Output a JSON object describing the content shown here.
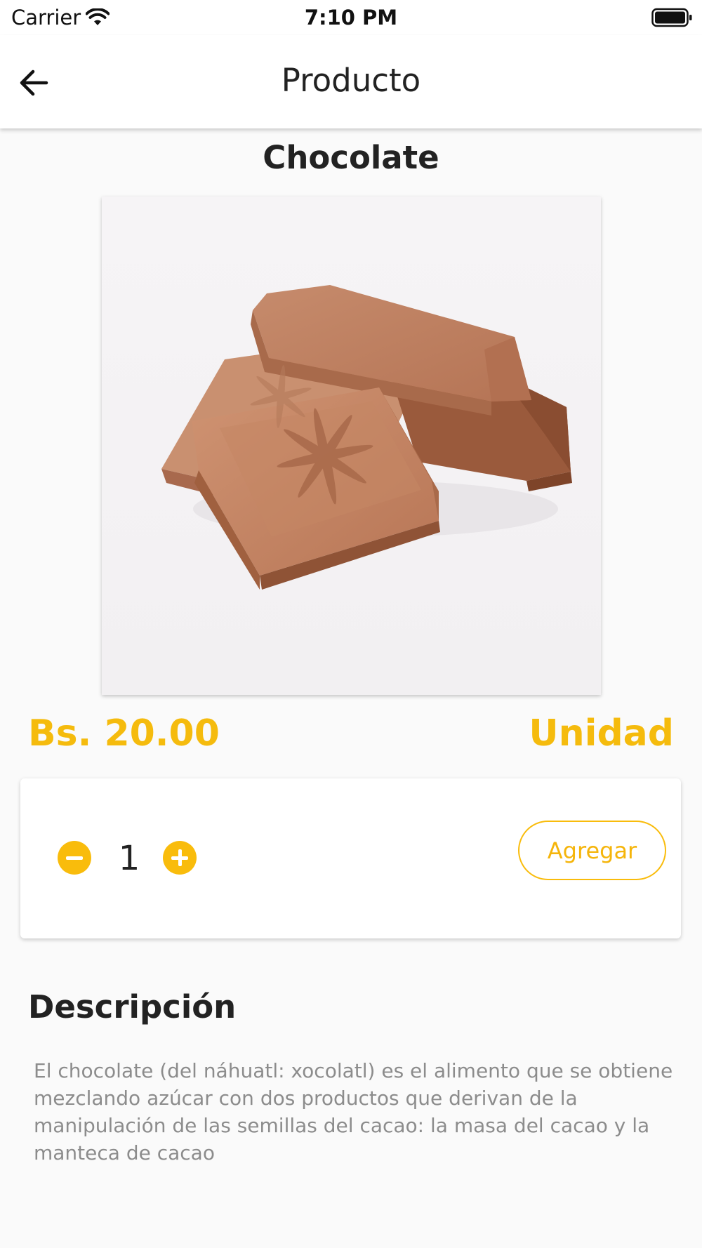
{
  "status_bar": {
    "carrier": "Carrier",
    "time": "7:10 PM",
    "wifi_icon": "wifi-icon",
    "battery_icon": "battery-icon"
  },
  "app_bar": {
    "title": "Producto",
    "back_icon": "arrow-left-icon"
  },
  "product": {
    "name": "Chocolate",
    "image_subject": "chocolate-pieces",
    "price": "Bs. 20.00",
    "unit": "Unidad"
  },
  "quantity": {
    "value": "1",
    "minus_icon": "minus-circle-icon",
    "plus_icon": "plus-circle-icon",
    "add_label": "Agregar"
  },
  "description": {
    "title": "Descripción",
    "text": "El chocolate (del náhuatl: xocolatl) es el alimento que se obtiene mezclando azúcar con dos productos que derivan de la manipulación de las semillas del cacao: la masa del cacao y la manteca de cacao"
  },
  "colors": {
    "accent": "#f9bc0c",
    "background": "#fafafa",
    "text_dark": "#222222",
    "text_muted": "#8c8c8c"
  }
}
